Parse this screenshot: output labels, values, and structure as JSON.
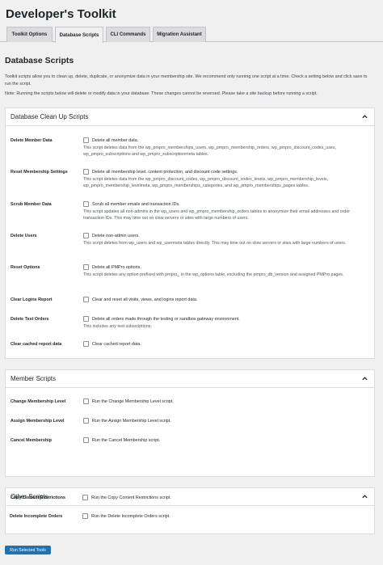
{
  "page_title": "Developer's Toolkit",
  "tabs": [
    "Toolkit Options",
    "Database Scripts",
    "CLI Commands",
    "Migration Assistant"
  ],
  "section_title": "Database Scripts",
  "intro": "Toolkit scripts allow you to clean up, delete, duplicate, or anonymize data in your membership site. We recommend only running one script at a time. Check a setting below and click save to run the script.",
  "note": "Note: Running the scripts below will delete or modify data in your database. These changes cannot be reversed. Please take a site backup before running a script.",
  "cards": [
    {
      "title": "Database Clean Up Scripts",
      "rows": [
        {
          "label": "Delete Member Data",
          "option": "Delete all member data.",
          "desc": "This script deletes data from the wp_pmpro_memberships_users, wp_pmpro_membership_orders, wp_pmpro_discount_codes_uses, wp_pmpro_subscriptions and wp_pmpro_subscriptionmeta tables."
        },
        {
          "label": "Reset Membership Settings",
          "option": "Delete all membership level, content protection, and discount code settings.",
          "desc": "This script deletes data from the wp_pmpro_discount_codes, wp_pmpro_discount_codes_levels, wp_pmpro_membership_levels, wp_pmpro_membership_levelmeta, wp_pmpro_memberships_categories, and wp_pmpro_memberships_pages tables."
        },
        {
          "label": "Scrub Member Data",
          "option": "Scrub all member emails and transaction IDs.",
          "desc": "This script updates all non-admins in the wp_users and wp_pmpro_membership_orders tables to anonymize their email addresses and order transaction IDs. This may time out on slow servers or sites with large numbers of users."
        },
        {
          "label": "Delete Users",
          "option": "Delete non-admin users.",
          "desc": "This script deletes from wp_users and wp_usermeta tables directly. This may time out on slow servers or sites with large numbers of users."
        },
        {
          "label": "Reset Options",
          "option": "Delete all PMPro options.",
          "desc": "This script deletes any option prefixed with pmpro_ in the wp_options table, excluding the pmpro_db_version and assigned PMPro pages."
        },
        {
          "label": "Clear Logins Report",
          "option": "Clear and reset all visits, views, and logins report data.",
          "desc": ""
        },
        {
          "label": "Delete Test Orders",
          "option": "Delete all orders made through the testing or sandbox gateway environment.",
          "desc": "This includes any test subscriptions."
        },
        {
          "label": "Clear cached report data",
          "option": "Clear cached report data.",
          "desc": ""
        }
      ]
    },
    {
      "title": "Member Scripts",
      "rows": [
        {
          "label": "Change Membership Level",
          "option": "Run the Change Membership Level script.",
          "desc": ""
        },
        {
          "label": "Assign Membership Level",
          "option": "Run the Assign Membership Level script.",
          "desc": ""
        },
        {
          "label": "Cancel Membership",
          "option": "Run the Cancel Membership script.",
          "desc": ""
        }
      ]
    },
    {
      "title": "Other Scripts",
      "rows": [
        {
          "label": "Copy Content Restrictions",
          "option": "Run the Copy Content Restrictions script.",
          "desc": ""
        },
        {
          "label": "Delete Incomplete Orders",
          "option": "Run the Delete Incomplete Orders script.",
          "desc": ""
        }
      ]
    }
  ],
  "run_button": "Run Selected Tools",
  "icons": {
    "collapse": "chevron-up-icon",
    "checkbox": "checkbox-icon"
  },
  "colors": {
    "primary": "#2271b1",
    "background": "#f0f0f1"
  }
}
